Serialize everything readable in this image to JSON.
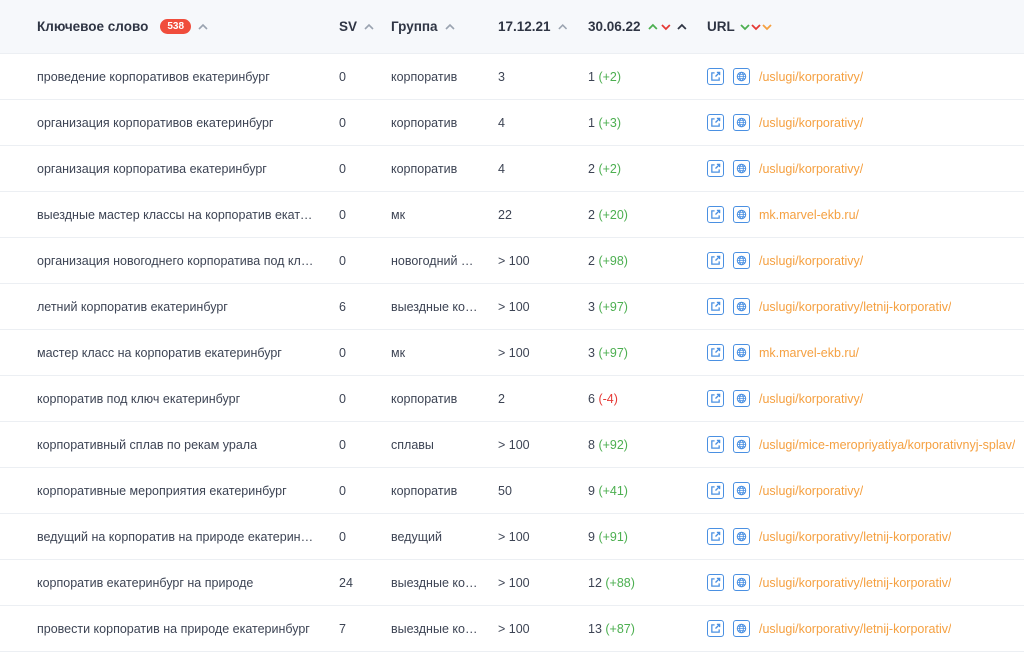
{
  "header": {
    "keyword": "Ключевое слово",
    "keyword_count": "538",
    "sv": "SV",
    "group": "Группа",
    "date1": "17.12.21",
    "date2": "30.06.22",
    "url": "URL"
  },
  "colors": {
    "accent": "#4a90e2",
    "positive": "#4caf50",
    "negative": "#e53935",
    "link": "#f5a040",
    "badge": "#f04d3c"
  },
  "rows": [
    {
      "keyword": "проведение корпоративов екатеринбург",
      "sv": "0",
      "group": "корпоратив",
      "d1": "3",
      "d2": "1",
      "delta": "(+2)",
      "dir": "pos",
      "url": "/uslugi/korporativy/"
    },
    {
      "keyword": "организация корпоративов екатеринбург",
      "sv": "0",
      "group": "корпоратив",
      "d1": "4",
      "d2": "1",
      "delta": "(+3)",
      "dir": "pos",
      "url": "/uslugi/korporativy/"
    },
    {
      "keyword": "организация корпоратива екатеринбург",
      "sv": "0",
      "group": "корпоратив",
      "d1": "4",
      "d2": "2",
      "delta": "(+2)",
      "dir": "pos",
      "url": "/uslugi/korporativy/"
    },
    {
      "keyword": "выездные мастер классы на корпоратив екатеринбург",
      "sv": "0",
      "group": "мк",
      "d1": "22",
      "d2": "2",
      "delta": "(+20)",
      "dir": "pos",
      "url": "mk.marvel-ekb.ru/"
    },
    {
      "keyword": "организация новогоднего корпоратива под ключ екатеринбург",
      "sv": "0",
      "group": "новогодний корпоратив",
      "d1": "> 100",
      "d2": "2",
      "delta": "(+98)",
      "dir": "pos",
      "url": "/uslugi/korporativy/"
    },
    {
      "keyword": "летний корпоратив екатеринбург",
      "sv": "6",
      "group": "выездные корпоративы",
      "d1": "> 100",
      "d2": "3",
      "delta": "(+97)",
      "dir": "pos",
      "url": "/uslugi/korporativy/letnij-korporativ/"
    },
    {
      "keyword": "мастер класс на корпоратив екатеринбург",
      "sv": "0",
      "group": "мк",
      "d1": "> 100",
      "d2": "3",
      "delta": "(+97)",
      "dir": "pos",
      "url": "mk.marvel-ekb.ru/"
    },
    {
      "keyword": "корпоратив под ключ екатеринбург",
      "sv": "0",
      "group": "корпоратив",
      "d1": "2",
      "d2": "6",
      "delta": "(-4)",
      "dir": "neg",
      "url": "/uslugi/korporativy/"
    },
    {
      "keyword": "корпоративный сплав по рекам урала",
      "sv": "0",
      "group": "сплавы",
      "d1": "> 100",
      "d2": "8",
      "delta": "(+92)",
      "dir": "pos",
      "url": "/uslugi/mice-meropriyatiya/korporativnyj-splav/"
    },
    {
      "keyword": "корпоративные мероприятия екатеринбург",
      "sv": "0",
      "group": "корпоратив",
      "d1": "50",
      "d2": "9",
      "delta": "(+41)",
      "dir": "pos",
      "url": "/uslugi/korporativy/"
    },
    {
      "keyword": "ведущий на корпоратив на природе екатеринбург",
      "sv": "0",
      "group": "ведущий",
      "d1": "> 100",
      "d2": "9",
      "delta": "(+91)",
      "dir": "pos",
      "url": "/uslugi/korporativy/letnij-korporativ/"
    },
    {
      "keyword": "корпоратив екатеринбург на природе",
      "sv": "24",
      "group": "выездные корпоративы",
      "d1": "> 100",
      "d2": "12",
      "delta": "(+88)",
      "dir": "pos",
      "url": "/uslugi/korporativy/letnij-korporativ/"
    },
    {
      "keyword": "провести корпоратив на природе екатеринбург",
      "sv": "7",
      "group": "выездные корпоративы",
      "d1": "> 100",
      "d2": "13",
      "delta": "(+87)",
      "dir": "pos",
      "url": "/uslugi/korporativy/letnij-korporativ/"
    }
  ]
}
